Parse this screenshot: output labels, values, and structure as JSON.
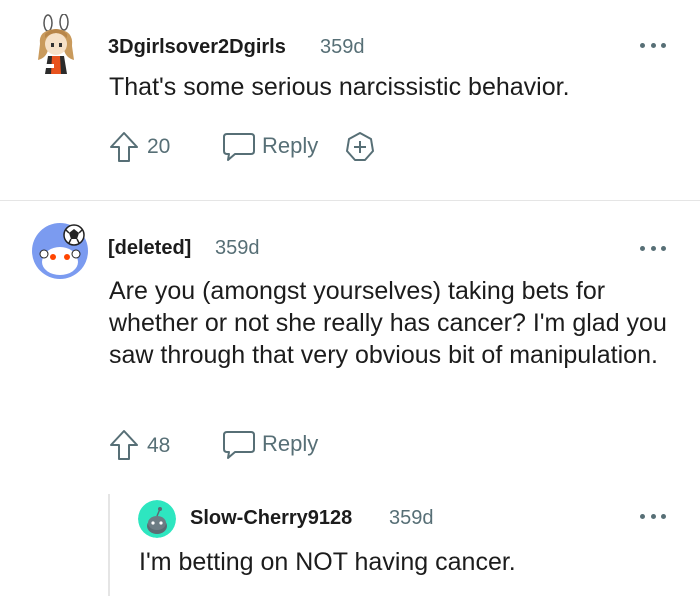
{
  "comments": [
    {
      "username": "3Dgirlsover2Dgirls",
      "age": "359d",
      "body": "That's some serious narcissistic behavior.",
      "votes": "20",
      "reply_label": "Reply",
      "icons": {
        "avatar": "anime-girl-avatar",
        "upvote": "upvote-arrow-icon",
        "reply": "speech-bubble-icon",
        "award": "award-plus-icon",
        "more": "more-options-icon"
      }
    },
    {
      "username": "[deleted]",
      "age": "359d",
      "body": "Are you (amongst yourselves) taking bets for whether or not she really has cancer? I'm glad you saw through that very obvious bit of manipulation.",
      "votes": "48",
      "reply_label": "Reply",
      "icons": {
        "avatar": "snoo-soccer-avatar",
        "upvote": "upvote-arrow-icon",
        "reply": "speech-bubble-icon",
        "more": "more-options-icon"
      }
    },
    {
      "username": "Slow-Cherry9128",
      "age": "359d",
      "body": "I'm betting on NOT having cancer.",
      "icons": {
        "avatar": "snoo-default-avatar",
        "more": "more-options-icon"
      }
    }
  ],
  "colors": {
    "meta": "#576f76",
    "text": "#1c1c1c",
    "divider": "#e5e5e5",
    "avatar_blue": "#7b9bf0",
    "avatar_teal": "#2ee6c0"
  }
}
